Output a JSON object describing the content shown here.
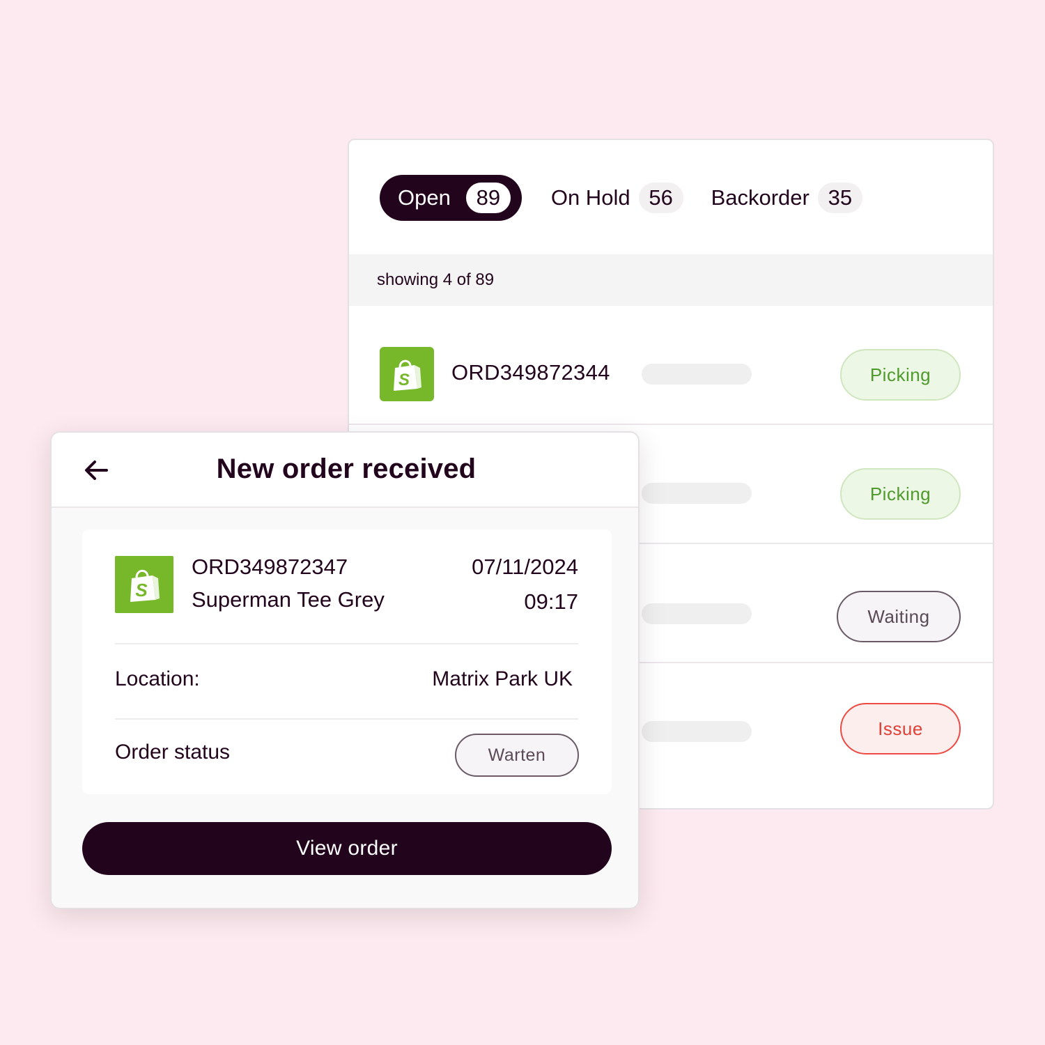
{
  "colors": {
    "background": "#fdeaf0",
    "brand_dark": "#22051d",
    "shopify_green": "#76b82a",
    "picking_text": "#4e9a2b",
    "issue_text": "#e33f36",
    "waiting_text": "#5a4a57"
  },
  "tabs": [
    {
      "label": "Open",
      "count": "89",
      "active": true
    },
    {
      "label": "On Hold",
      "count": "56",
      "active": false
    },
    {
      "label": "Backorder",
      "count": "35",
      "active": false
    }
  ],
  "showing_text": "showing 4 of 89",
  "orders": [
    {
      "id": "ORD349872344",
      "status": "Picking",
      "icon": "shopify-bag-icon"
    },
    {
      "id": "",
      "status": "Picking"
    },
    {
      "id": "",
      "status": "Waiting"
    },
    {
      "id": "",
      "status": "Issue"
    }
  ],
  "modal": {
    "title": "New order received",
    "back_icon": "arrow-left-icon",
    "card": {
      "order_id": "ORD349872347",
      "product": "Superman Tee Grey",
      "date": "07/11/2024",
      "time": "09:17",
      "location_label": "Location:",
      "location_value": "Matrix Park UK",
      "status_label": "Order status",
      "status_value": "Warten",
      "icon": "shopify-bag-icon"
    },
    "view_button": "View order"
  }
}
